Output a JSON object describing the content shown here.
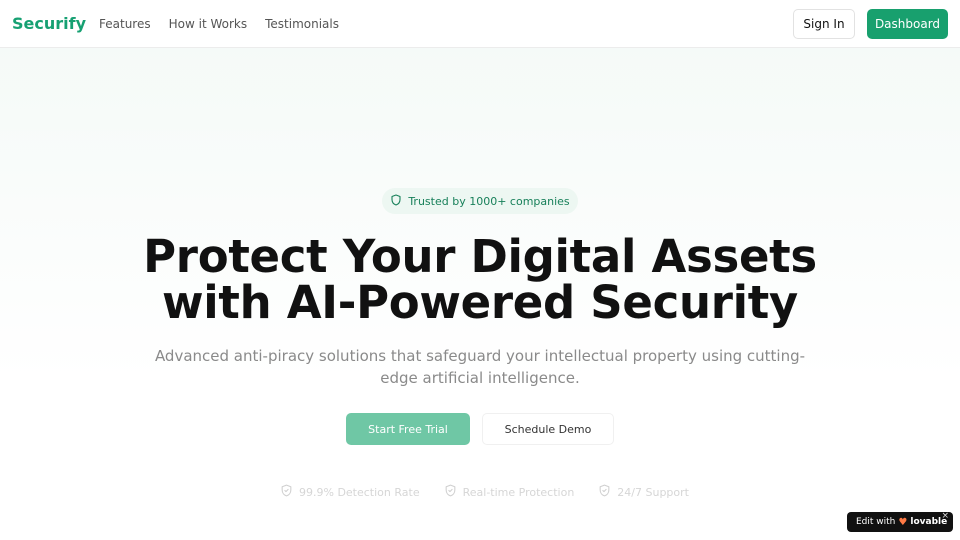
{
  "header": {
    "logo": "Securify",
    "nav_links": [
      "Features",
      "How it Works",
      "Testimonials"
    ],
    "sign_in_label": "Sign In",
    "dashboard_label": "Dashboard"
  },
  "hero": {
    "badge_text": "Trusted by 1000+ companies",
    "title_line1": "Protect Your Digital Assets",
    "title_line2": "with AI-Powered Security",
    "subtitle_line1": "Advanced anti-piracy solutions that safeguard your intellectual property using cutting-",
    "subtitle_line2": "edge artificial intelligence.",
    "primary_cta": "Start Free Trial",
    "secondary_cta": "Schedule Demo",
    "features": [
      "99.9% Detection Rate",
      "Real-time Protection",
      "24/7 Support"
    ]
  },
  "badge_widget": {
    "edit_with": "Edit with",
    "brand": "lovable",
    "close": "×"
  },
  "colors": {
    "brand_green": "#16a072",
    "button_green": "#18a06e",
    "trial_button": "#6fc7a5"
  },
  "icons": {
    "badge_icon": "shield-icon",
    "feature_icon": "shield-check-icon",
    "brand_icon": "heart-icon"
  }
}
